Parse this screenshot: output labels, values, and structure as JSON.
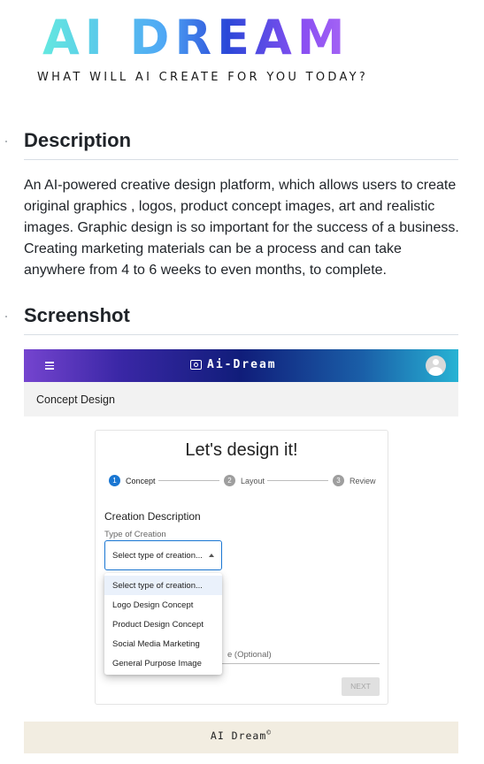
{
  "header": {
    "logo_text": "AI DREAM",
    "tagline": "WHAT WILL AI CREATE FOR YOU TODAY?"
  },
  "description": {
    "heading": "Description",
    "body": "An AI-powered creative design platform, which allows users to create original graphics , logos, product concept images, art and realistic images. Graphic design is so important for the success of a business. Creating marketing materials can be a process and can take anywhere from 4 to 6 weeks to even months, to complete."
  },
  "screenshot": {
    "heading": "Screenshot",
    "app": {
      "title": "Ai-Dream",
      "menu_icon": "hamburger-menu-icon",
      "logo_icon": "camera-icon",
      "avatar_icon": "user-avatar-icon",
      "gradient_colors": [
        "#7544cf",
        "#101d7a",
        "#27b3d4"
      ],
      "subheader": "Concept Design",
      "card": {
        "title": "Let's design it!",
        "steps": [
          {
            "num": "1",
            "label": "Concept",
            "active": true
          },
          {
            "num": "2",
            "label": "Layout",
            "active": false
          },
          {
            "num": "3",
            "label": "Review",
            "active": false
          }
        ],
        "section_label": "Creation Description",
        "type_label": "Type of Creation",
        "select_value": "Select type of creation...",
        "partial_field_label": "e (Optional)",
        "next_button": "NEXT",
        "accent_color": "#1976d2"
      },
      "dropdown_options": [
        "Select type of creation...",
        "Logo Design Concept",
        "Product Design Concept",
        "Social Media Marketing",
        "General Purpose Image"
      ]
    }
  },
  "footer": {
    "text": "AI Dream",
    "symbol": "©"
  }
}
